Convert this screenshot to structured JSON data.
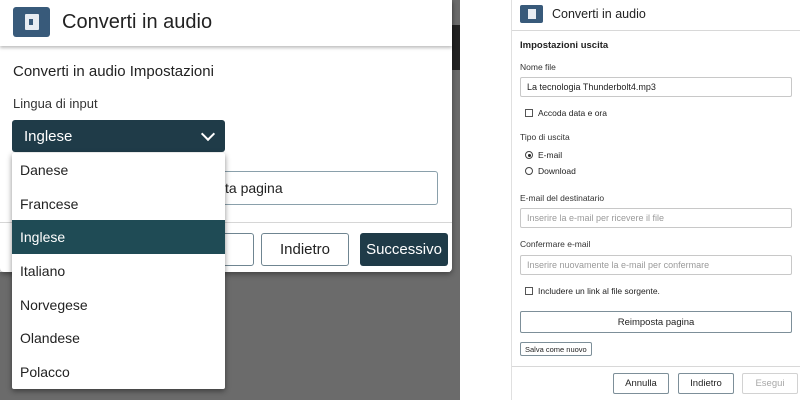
{
  "left": {
    "title": "Converti in audio",
    "section_title": "Converti in audio Impostazioni",
    "language_label": "Lingua di input",
    "selected_language": "Inglese",
    "language_options": [
      "Danese",
      "Francese",
      "Inglese",
      "Italiano",
      "Norvegese",
      "Olandese",
      "Polacco"
    ],
    "reset_partial": "ta pagina",
    "back_label": "Indietro",
    "next_label": "Successivo"
  },
  "right": {
    "title": "Converti in audio",
    "section_title": "Impostazioni uscita",
    "filename_label": "Nome file",
    "filename_value": "La tecnologia Thunderbolt4.mp3",
    "append_datetime_label": "Accoda data e ora",
    "output_type_label": "Tipo di uscita",
    "output_email_label": "E-mail",
    "output_download_label": "Download",
    "recipient_label": "E-mail del destinatario",
    "recipient_placeholder": "Inserire la e-mail per ricevere il file",
    "confirm_label": "Confermare e-mail",
    "confirm_placeholder": "Inserire nuovamente la e-mail per confermare",
    "include_link_label": "Includere un link al file sorgente.",
    "reset_label": "Reimposta pagina",
    "save_as_new_label": "Salva come nuovo",
    "cancel_label": "Annulla",
    "back_label": "Indietro",
    "run_label": "Esegui"
  },
  "colors": {
    "primary": "#1f3b48",
    "selected_item": "#1f4b55",
    "app_icon": "#385a7a",
    "overlay": "#6b6b6b"
  },
  "icons": [
    "audio-file-icon",
    "chevron-down-icon"
  ]
}
